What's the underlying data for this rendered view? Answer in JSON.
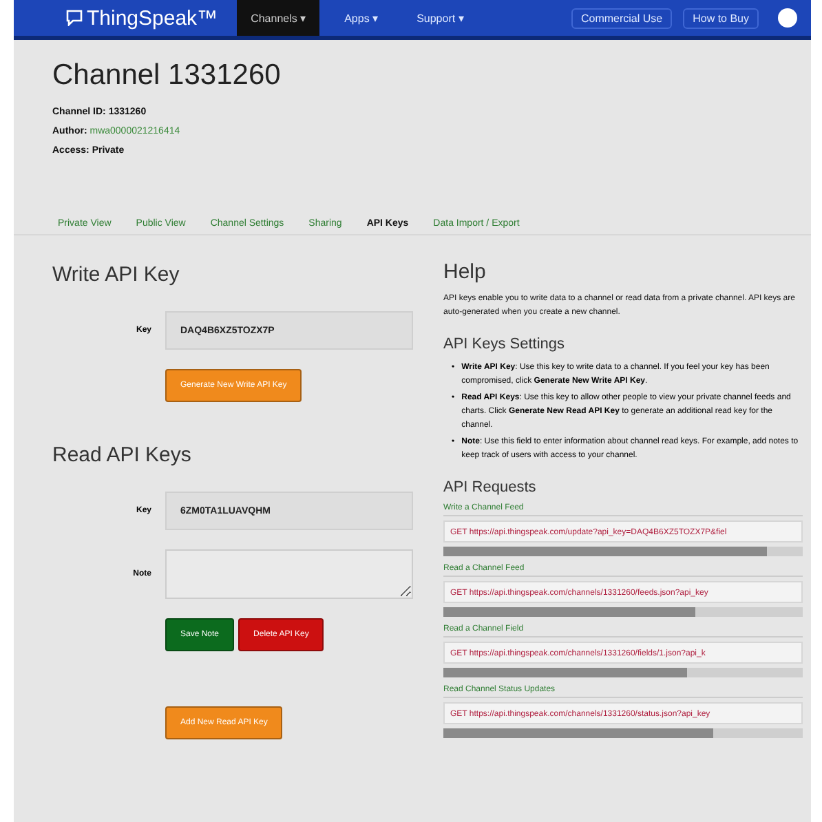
{
  "navbar": {
    "logo": "ThingSpeak™",
    "menus": [
      {
        "label": "Channels ▾",
        "selected": true
      },
      {
        "label": "Apps ▾",
        "selected": false
      },
      {
        "label": "Support ▾",
        "selected": false
      }
    ],
    "links": [
      "Commercial Use",
      "How to Buy"
    ]
  },
  "channel": {
    "title": "Channel 1331260",
    "meta": [
      {
        "label": "Channel ID:",
        "value": "1331260",
        "kind": "bold"
      },
      {
        "label": "Author:",
        "value": "mwa0000021216414",
        "kind": "link"
      },
      {
        "label": "Access:",
        "value": "Private",
        "kind": "plain"
      }
    ]
  },
  "tabs": [
    {
      "label": "Private View",
      "selected": false
    },
    {
      "label": "Public View",
      "selected": false
    },
    {
      "label": "Channel Settings",
      "selected": false
    },
    {
      "label": "Sharing",
      "selected": false
    },
    {
      "label": "API Keys",
      "selected": true
    },
    {
      "label": "Data Import / Export",
      "selected": false
    }
  ],
  "write_key": {
    "title": "Write API Key",
    "key_label": "Key",
    "key": "DAQ4B6XZ5TOZX7P",
    "button": "Generate New Write API Key"
  },
  "read_keys": {
    "title": "Read API Keys",
    "key_label": "Key",
    "key": "6ZM0TA1LUAVQHM",
    "note_label": "Note",
    "buttons": [
      {
        "label": "Save Note",
        "kind": "save"
      },
      {
        "label": "Delete API Key",
        "kind": "delete"
      }
    ],
    "add_button": "Add New Read API Key"
  },
  "help": {
    "title": "Help",
    "text": "API keys enable you to write data to a channel or read data from a private channel. API keys are auto-generated when you create a new channel.",
    "settings_title": "API Keys Settings",
    "bullets": [
      {
        "marker": "•",
        "text": "**Write API Key**: Use this key to write data to a channel. If you feel your key has been compromised, click **Generate New Write API Key**."
      },
      {
        "marker": "•",
        "text": "**Read API Keys**: Use this key to allow other people to view your private channel feeds and charts. Click **Generate New Read API Key** to generate an additional read key for the channel."
      },
      {
        "marker": "•",
        "text": "**Note**: Use this field to enter information about channel read keys. For example, add notes to keep track of users with access to your channel."
      }
    ]
  },
  "api_requests": {
    "title": "API Requests",
    "items": [
      {
        "title": "Write a Channel Feed",
        "code": "GET https://api.thingspeak.com/update?api_key=DAQ4B6XZ5TOZX7P&fiel"
      },
      {
        "title": "Read a Channel Feed",
        "code": "GET https://api.thingspeak.com/channels/1331260/feeds.json?api_key"
      },
      {
        "title": "Read a Channel Field",
        "code": "GET https://api.thingspeak.com/channels/1331260/fields/1.json?api_k"
      },
      {
        "title": "Read Channel Status Updates",
        "code": "GET https://api.thingspeak.com/channels/1331260/status.json?api_key"
      }
    ]
  }
}
